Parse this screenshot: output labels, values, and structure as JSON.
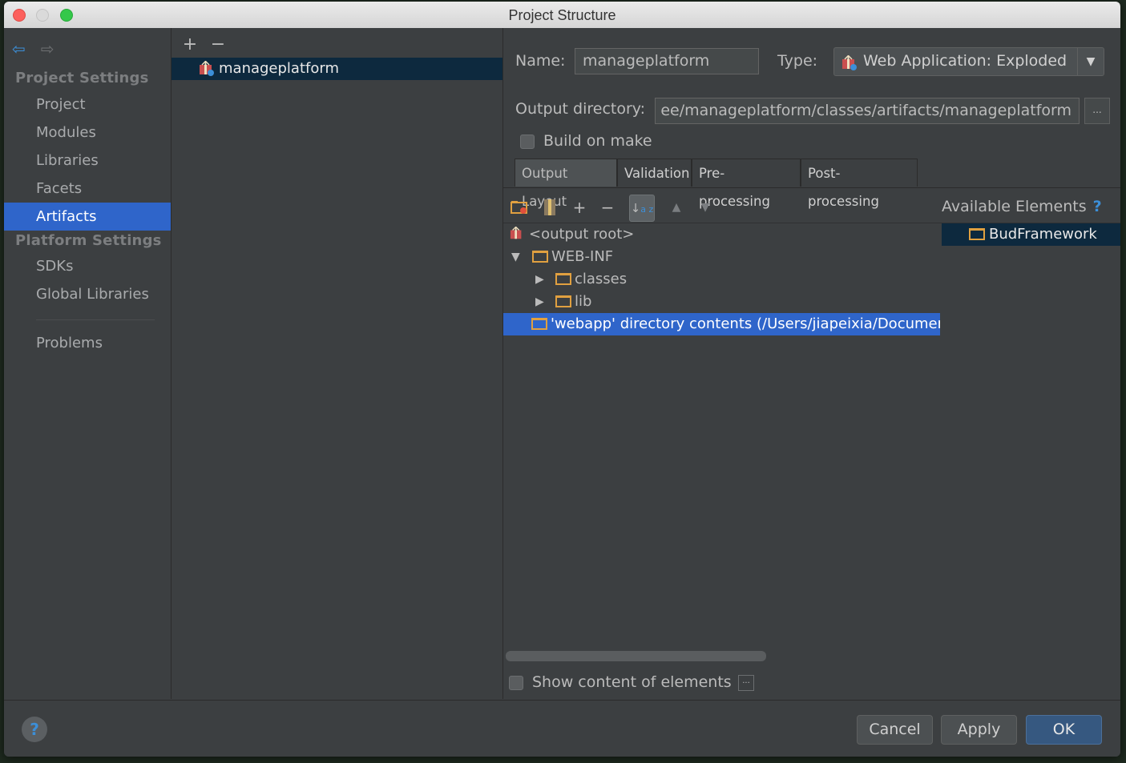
{
  "window": {
    "title": "Project Structure"
  },
  "sidebar": {
    "project_settings_header": "Project Settings",
    "project_items": [
      {
        "label": "Project"
      },
      {
        "label": "Modules"
      },
      {
        "label": "Libraries"
      },
      {
        "label": "Facets"
      },
      {
        "label": "Artifacts",
        "selected": true
      }
    ],
    "platform_settings_header": "Platform Settings",
    "platform_items": [
      {
        "label": "SDKs"
      },
      {
        "label": "Global Libraries"
      }
    ],
    "problems_label": "Problems"
  },
  "artifacts_list": {
    "add_icon": "+",
    "remove_icon": "−",
    "items": [
      {
        "label": "manageplatform",
        "selected": true
      }
    ]
  },
  "config": {
    "name_label": "Name:",
    "name_value": "manageplatform",
    "type_label": "Type:",
    "type_value": "Web Application: Exploded",
    "output_dir_label": "Output directory:",
    "output_dir_value": "ee/manageplatform/classes/artifacts/manageplatform",
    "browse_label": "...",
    "build_on_make_label": "Build on make",
    "build_on_make_checked": false,
    "tabs": [
      {
        "label": "Output Layout",
        "active": true
      },
      {
        "label": "Validation"
      },
      {
        "label": "Pre-processing"
      },
      {
        "label": "Post-processing"
      }
    ]
  },
  "layout_tree": {
    "toolbar": {
      "plus": "+",
      "minus": "−"
    },
    "rows": [
      {
        "label": "<output root>"
      },
      {
        "label": "WEB-INF",
        "expanded": true
      },
      {
        "label": "classes"
      },
      {
        "label": "lib"
      },
      {
        "label": "'webapp' directory contents (/Users/jiapeixia/Documents",
        "selected": true
      }
    ]
  },
  "available": {
    "header": "Available Elements",
    "help": "?",
    "items": [
      {
        "label": "BudFramework"
      }
    ]
  },
  "show_content": {
    "label": "Show content of elements",
    "checked": false,
    "ellipsis": "..."
  },
  "footer": {
    "help": "?",
    "cancel": "Cancel",
    "apply": "Apply",
    "ok": "OK"
  },
  "colors": {
    "selection": "#2f65ca",
    "inactive_selection": "#0d293e",
    "panel": "#3c3f41",
    "accent_blue": "#3c8fd8",
    "folder": "#e0a040"
  }
}
